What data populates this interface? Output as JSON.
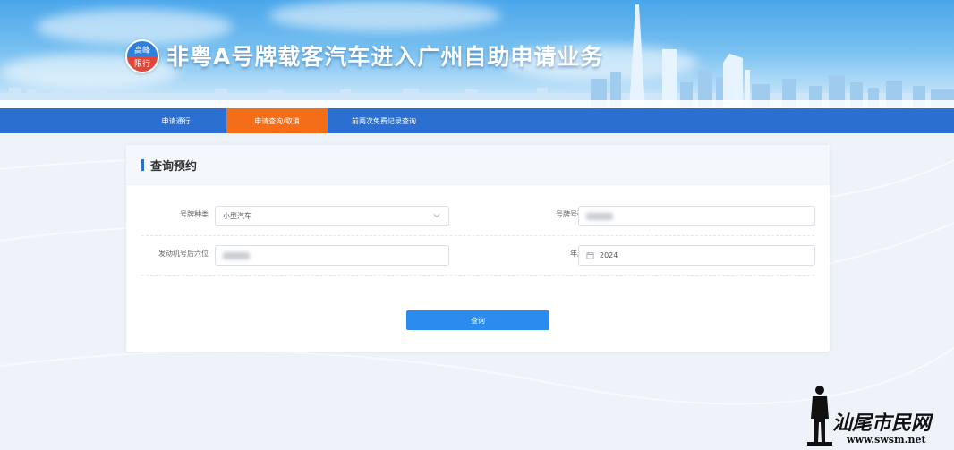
{
  "banner": {
    "badge_top": "高峰",
    "badge_bottom": "限行",
    "title": "非粤A号牌载客汽车进入广州自助申请业务"
  },
  "nav": {
    "items": [
      {
        "label": "申请通行"
      },
      {
        "label": "申请查询/取消"
      },
      {
        "label": "前两次免费记录查询"
      }
    ],
    "active_index": 1,
    "colors": {
      "bar": "#2b6fd1",
      "active": "#f46e1a"
    }
  },
  "card": {
    "title": "查询预约"
  },
  "form": {
    "plate_type_label": "号牌种类",
    "plate_type_value": "小型汽车",
    "plate_number_label": "号牌号码",
    "plate_number_value": "",
    "engine_label": "发动机号后六位",
    "engine_value": "",
    "year_label": "年度",
    "year_value": "2024"
  },
  "actions": {
    "query_label": "查询",
    "button_color": "#2b8bef"
  },
  "watermark": {
    "text": "汕尾市民网",
    "url": "www.swsm.net"
  }
}
